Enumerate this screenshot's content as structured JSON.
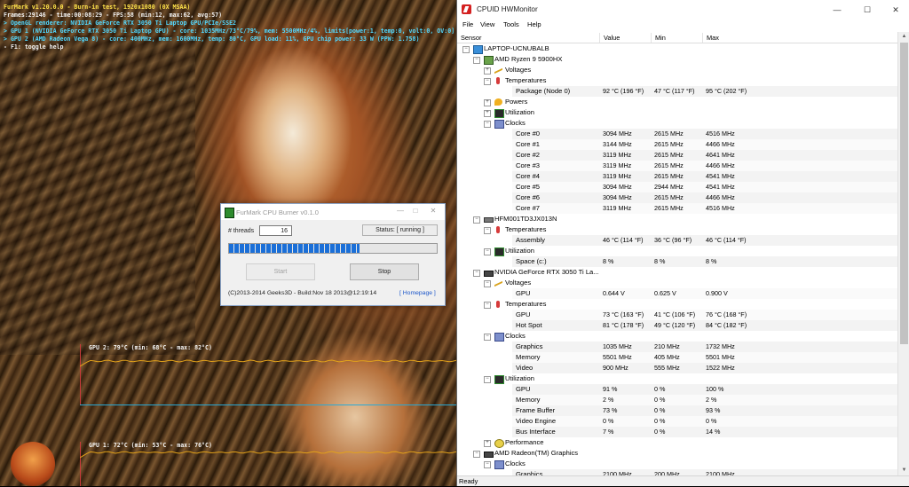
{
  "furmark": {
    "overlay": [
      {
        "text": "FurMark v1.20.0.0 - Burn-in test, 1920x1080 (0X MSAA)",
        "color": "yellow"
      },
      {
        "text": "Frames:29146 - time:00:08:29 - FPS:58 (min:12, max:62, avg:57)",
        "color": "white"
      },
      {
        "text": "> OpenGL renderer: NVIDIA GeForce RTX 3050 Ti Laptop GPU/PCIe/SSE2",
        "color": "cyan"
      },
      {
        "text": "> GPU 1 (NVIDIA GeForce RTX 3050 Ti Laptop GPU) - core: 1035MHz/73°C/79%, mem: 5500MHz/4%, limits[power:1, temp:0, volt:0, OV:0]",
        "color": "cyan"
      },
      {
        "text": "> GPU 2 (AMD Radeon Vega 8) - core: 400MHz, mem: 1600MHz, temp: 80°C, GPU load: 11%, GPU chip power: 33 W (PPW: 1.758)",
        "color": "cyan"
      },
      {
        "text": "- F1: toggle help",
        "color": "white"
      }
    ],
    "graph_gpu2": "GPU 2: 79°C (min: 68°C - max: 82°C)",
    "graph_gpu1": "GPU 1: 72°C (min: 53°C - max: 76°C)",
    "colors": {
      "yellow": "#ffe34a",
      "cyan": "#52d8ff",
      "temp_line": "#e3a21a"
    }
  },
  "burner": {
    "title": "FurMark CPU Burner v0.1.0",
    "minimize": "—",
    "maximize": "□",
    "close": "✕",
    "threads_label": "# threads",
    "threads_value": "16",
    "status": "Status: [ running ]",
    "progress_fraction": 0.63,
    "start_label": "Start",
    "stop_label": "Stop",
    "footer": "(C)2013-2014 Geeks3D - Build:Nov 18 2013@12:19:14",
    "homepage": "[ Homepage ]"
  },
  "hwmon": {
    "title": "CPUID HWMonitor",
    "minimize": "—",
    "maximize": "☐",
    "close": "✕",
    "menu": [
      "File",
      "View",
      "Tools",
      "Help"
    ],
    "columns": [
      "Sensor",
      "Value",
      "Min",
      "Max"
    ],
    "status": "Ready",
    "rows": [
      {
        "level": 0,
        "exp": "−",
        "icon": "ico-computer",
        "label": "LAPTOP-UCNUBALB"
      },
      {
        "level": 1,
        "exp": "−",
        "icon": "ico-cpu",
        "label": "AMD Ryzen 9 5900HX"
      },
      {
        "level": 2,
        "exp": "+",
        "icon": "ico-volt",
        "label": "Voltages"
      },
      {
        "level": 2,
        "exp": "−",
        "icon": "ico-temp",
        "label": "Temperatures"
      },
      {
        "level": 3,
        "label": "Package (Node 0)",
        "value": "92 °C  (196 °F)",
        "min": "47 °C  (117 °F)",
        "max": "95 °C  (202 °F)"
      },
      {
        "level": 2,
        "exp": "+",
        "icon": "ico-power",
        "label": "Powers"
      },
      {
        "level": 2,
        "exp": "+",
        "icon": "ico-util",
        "label": "Utilization"
      },
      {
        "level": 2,
        "exp": "−",
        "icon": "ico-clock",
        "label": "Clocks"
      },
      {
        "level": 3,
        "label": "Core #0",
        "value": "3094 MHz",
        "min": "2615 MHz",
        "max": "4516 MHz"
      },
      {
        "level": 3,
        "label": "Core #1",
        "value": "3144 MHz",
        "min": "2615 MHz",
        "max": "4466 MHz"
      },
      {
        "level": 3,
        "label": "Core #2",
        "value": "3119 MHz",
        "min": "2615 MHz",
        "max": "4641 MHz"
      },
      {
        "level": 3,
        "label": "Core #3",
        "value": "3119 MHz",
        "min": "2615 MHz",
        "max": "4466 MHz"
      },
      {
        "level": 3,
        "label": "Core #4",
        "value": "3119 MHz",
        "min": "2615 MHz",
        "max": "4541 MHz"
      },
      {
        "level": 3,
        "label": "Core #5",
        "value": "3094 MHz",
        "min": "2944 MHz",
        "max": "4541 MHz"
      },
      {
        "level": 3,
        "label": "Core #6",
        "value": "3094 MHz",
        "min": "2615 MHz",
        "max": "4466 MHz"
      },
      {
        "level": 3,
        "label": "Core #7",
        "value": "3119 MHz",
        "min": "2615 MHz",
        "max": "4516 MHz"
      },
      {
        "level": 1,
        "exp": "−",
        "icon": "ico-disk",
        "label": "HFM001TD3JX013N"
      },
      {
        "level": 2,
        "exp": "−",
        "icon": "ico-temp",
        "label": "Temperatures"
      },
      {
        "level": 3,
        "label": "Assembly",
        "value": "46 °C  (114 °F)",
        "min": "36 °C  (96 °F)",
        "max": "46 °C  (114 °F)"
      },
      {
        "level": 2,
        "exp": "−",
        "icon": "ico-util",
        "label": "Utilization"
      },
      {
        "level": 3,
        "label": "Space (c:)",
        "value": "8 %",
        "min": "8 %",
        "max": "8 %"
      },
      {
        "level": 1,
        "exp": "−",
        "icon": "ico-gpu",
        "label": "NVIDIA GeForce RTX 3050 Ti La..."
      },
      {
        "level": 2,
        "exp": "−",
        "icon": "ico-volt",
        "label": "Voltages"
      },
      {
        "level": 3,
        "label": "GPU",
        "value": "0.644 V",
        "min": "0.625 V",
        "max": "0.900 V"
      },
      {
        "level": 2,
        "exp": "−",
        "icon": "ico-temp",
        "label": "Temperatures"
      },
      {
        "level": 3,
        "label": "GPU",
        "value": "73 °C  (163 °F)",
        "min": "41 °C  (106 °F)",
        "max": "76 °C  (168 °F)"
      },
      {
        "level": 3,
        "label": "Hot Spot",
        "value": "81 °C  (178 °F)",
        "min": "49 °C  (120 °F)",
        "max": "84 °C  (182 °F)"
      },
      {
        "level": 2,
        "exp": "−",
        "icon": "ico-clock",
        "label": "Clocks"
      },
      {
        "level": 3,
        "label": "Graphics",
        "value": "1035 MHz",
        "min": "210 MHz",
        "max": "1732 MHz"
      },
      {
        "level": 3,
        "label": "Memory",
        "value": "5501 MHz",
        "min": "405 MHz",
        "max": "5501 MHz"
      },
      {
        "level": 3,
        "label": "Video",
        "value": "900 MHz",
        "min": "555 MHz",
        "max": "1522 MHz"
      },
      {
        "level": 2,
        "exp": "−",
        "icon": "ico-util",
        "label": "Utilization"
      },
      {
        "level": 3,
        "label": "GPU",
        "value": "91 %",
        "min": "0 %",
        "max": "100 %"
      },
      {
        "level": 3,
        "label": "Memory",
        "value": "2 %",
        "min": "0 %",
        "max": "2 %"
      },
      {
        "level": 3,
        "label": "Frame Buffer",
        "value": "73 %",
        "min": "0 %",
        "max": "93 %"
      },
      {
        "level": 3,
        "label": "Video Engine",
        "value": "0 %",
        "min": "0 %",
        "max": "0 %"
      },
      {
        "level": 3,
        "label": "Bus Interface",
        "value": "7 %",
        "min": "0 %",
        "max": "14 %"
      },
      {
        "level": 2,
        "exp": "+",
        "icon": "ico-perf",
        "label": "Performance"
      },
      {
        "level": 1,
        "exp": "−",
        "icon": "ico-gpu",
        "label": "AMD Radeon(TM) Graphics"
      },
      {
        "level": 2,
        "exp": "−",
        "icon": "ico-clock",
        "label": "Clocks"
      },
      {
        "level": 3,
        "label": "Graphics",
        "value": "2100 MHz",
        "min": "200 MHz",
        "max": "2100 MHz"
      }
    ]
  }
}
